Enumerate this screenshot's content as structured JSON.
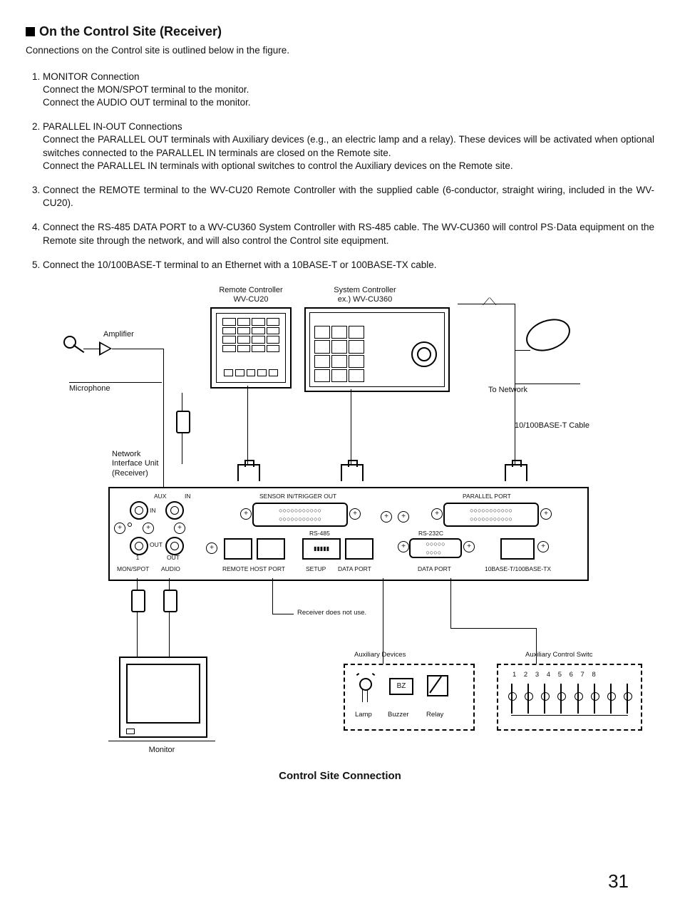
{
  "title": "On the Control Site (Receiver)",
  "intro": "Connections on the Control site is outlined below in the figure.",
  "steps": [
    {
      "head": "MONITOR Connection",
      "lines": [
        "Connect the MON/SPOT terminal to the monitor.",
        "Connect the AUDIO OUT terminal to the monitor."
      ]
    },
    {
      "head": "PARALLEL IN-OUT Connections",
      "lines": [
        "Connect the PARALLEL OUT terminals with Auxiliary devices (e.g., an electric lamp and a relay). These devices will be activated when optional switches connected to the PARALLEL IN terminals are closed on the Remote site.",
        "Connect the PARALLEL IN terminals with optional switches to control the Auxiliary devices on the Remote site."
      ]
    },
    {
      "head": "",
      "lines": [
        "Connect the REMOTE terminal to the WV-CU20 Remote Controller with the supplied cable (6-conductor, straight wiring, included in the WV-CU20)."
      ]
    },
    {
      "head": "",
      "lines": [
        "Connect the RS-485 DATA PORT to a WV-CU360 System Controller with RS-485 cable. The WV-CU360 will control PS·Data equipment on the Remote site through the  network, and will also control the Control site equipment."
      ]
    },
    {
      "head": "",
      "lines": [
        "Connect the 10/100BASE-T terminal to an Ethernet with a 10BASE-T or 100BASE-TX cable."
      ]
    }
  ],
  "diagram": {
    "remote_controller_title": "Remote Controller",
    "remote_controller_model": "WV-CU20",
    "system_controller_title": "System Controller",
    "system_controller_model": "ex.) WV-CU360",
    "amplifier": "Amplifier",
    "microphone": "Microphone",
    "to_network": "To Network",
    "cable": "10/100BASE-T Cable",
    "niu_1": "Network",
    "niu_2": "Interface Unit",
    "niu_3": "(Receiver)",
    "aux_label": "AUX",
    "in_label": "IN",
    "in_label2": "IN",
    "out_label": "OUT",
    "out_label2": "OUT",
    "one": "1",
    "mon_spot": "MON/SPOT",
    "audio": "AUDIO",
    "sensor_trigger": "SENSOR IN/TRIGGER OUT",
    "parallel_port": "PARALLEL PORT",
    "remote_host_port": "REMOTE HOST PORT",
    "setup": "SETUP",
    "data_port1": "DATA PORT",
    "data_port2": "DATA PORT",
    "rs485": "RS-485",
    "rs232c": "RS-232C",
    "tbase": "10BASE-T/100BASE-TX",
    "receiver_note": "Receiver does not use.",
    "aux_devices": "Auxiliary Devices",
    "lamp": "Lamp",
    "buzzer": "Buzzer",
    "relay": "Relay",
    "bz": "BZ",
    "aux_switches": "Auxiliary Control Switc",
    "switch_nums": "1  2  3  4  5  6  7  8",
    "monitor": "Monitor",
    "caption": "Control Site Connection"
  },
  "page_number": "31"
}
